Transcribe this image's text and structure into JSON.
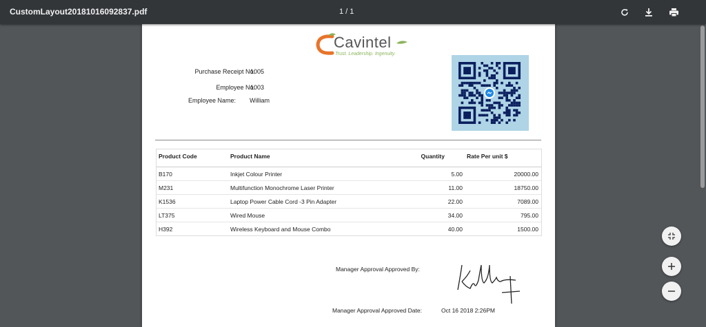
{
  "toolbar": {
    "file_name": "CustomLayout20181016092837.pdf",
    "page_indicator": "1 / 1",
    "icons": [
      "rotate-icon",
      "download-icon",
      "print-icon"
    ]
  },
  "receipt": {
    "logo": {
      "name": "Cavintel",
      "tagline": "Trust. Leadership. Ingenuity.",
      "accent": "#e8742a",
      "leaf": "#8ab45a"
    },
    "purchase_receipt_label": "Purchase Receipt No:",
    "purchase_receipt_value": "1005",
    "employee_no_label": "Employee No:",
    "employee_no_value": "1003",
    "employee_name_label": "Employee Name:",
    "employee_name_value": "William",
    "qr_bg": "#aed4e6"
  },
  "table": {
    "headers": [
      "Product Code",
      "Product Name",
      "Quantity",
      "Rate Per unit $"
    ],
    "rows": [
      [
        "B170",
        "Inkjet Colour Printer",
        "5.00",
        "20000.00"
      ],
      [
        "M231",
        "Multifunction Monochrome Laser Printer",
        "11.00",
        "18750.00"
      ],
      [
        "K1536",
        "Laptop Power Cable Cord -3 Pin Adapter",
        "22.00",
        "7089.00"
      ],
      [
        "LT375",
        "Wired Mouse",
        "34.00",
        "795.00"
      ],
      [
        "H392",
        "Wireless Keyboard and Mouse Combo",
        "40.00",
        "1500.00"
      ]
    ]
  },
  "approval": {
    "approved_by_label": "Manager Approval Approved By:",
    "approved_date_label": "Manager Approval Approved Date:",
    "approved_date_value": "Oct 16 2018 2:26PM"
  },
  "viewer_controls": [
    "fit-page-icon",
    "zoom-in-icon",
    "zoom-out-icon"
  ]
}
